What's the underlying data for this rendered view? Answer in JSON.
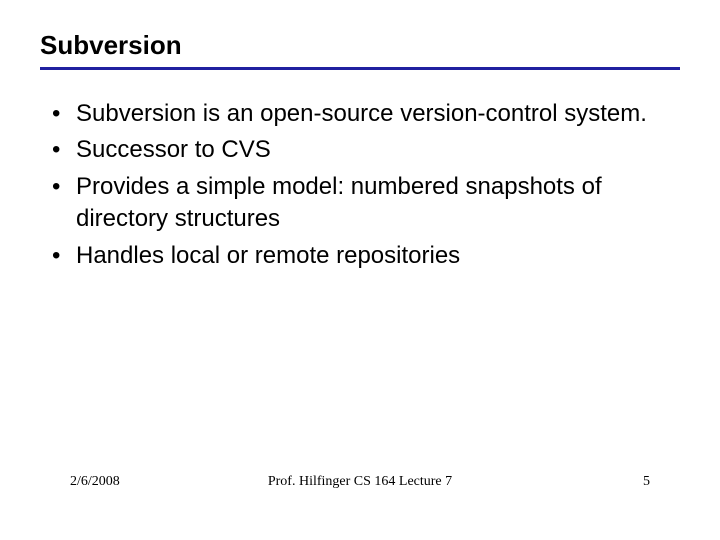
{
  "title": "Subversion",
  "bullets": [
    "Subversion is an open-source version-control system.",
    "Successor to CVS",
    "Provides a simple model: numbered snapshots of directory structures",
    "Handles local or remote repositories"
  ],
  "footer": {
    "date": "2/6/2008",
    "center": "Prof. Hilfinger CS 164 Lecture 7",
    "page": "5"
  }
}
